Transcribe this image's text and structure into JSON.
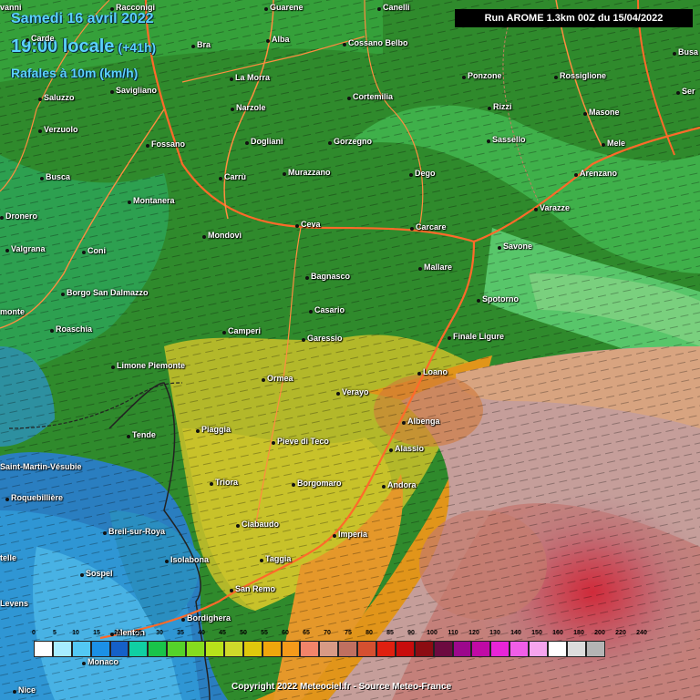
{
  "header": {
    "date_line": "Samedi 16 avril 2022",
    "time_line": "19:00 locale",
    "lead": "(+41h)",
    "param": "Rafales à 10m (km/h)",
    "run": "Run AROME 1.3km 00Z du 15/04/2022"
  },
  "cities": [
    "Racconigi",
    "Guarene",
    "Canelli",
    "Carde",
    "Bra",
    "Alba",
    "Cossano Belbo",
    "Saluzzo",
    "Savigliano",
    "La Morra",
    "Ponzone",
    "Rossiglione",
    "Narzole",
    "Cortemilia",
    "Rizzi",
    "Masone",
    "Verzuolo",
    "Dogliani",
    "Gorzegno",
    "Sassello",
    "Mele",
    "Fossano",
    "Busca",
    "Carrù",
    "Murazzano",
    "Dego",
    "Arenzano",
    "Montanera",
    "Varazze",
    "Dronero",
    "Mondovì",
    "Ceva",
    "Carcare",
    "Savone",
    "Valgrana",
    "Coni",
    "Mallare",
    "Bagnasco",
    "Spotorno",
    "Borgo San Dalmazzo",
    "Casario",
    "Roaschia",
    "Camperi",
    "Garessio",
    "Finale Ligure",
    "Limone Piemonte",
    "Loano",
    "Ormea",
    "Verayo",
    "Tende",
    "Piaggia",
    "Albenga",
    "Pieve di Teco",
    "Alassio",
    "Saint-Martin-Vésubie",
    "Triora",
    "Borgomaro",
    "Andora",
    "Roquebillière",
    "Breil-sur-Roya",
    "Ciabaudo",
    "Imperia",
    "Sospel",
    "Isolabona",
    "Taggia",
    "San Remo",
    "Levens",
    "Bordighera",
    "Menton",
    "Monaco",
    "Nice",
    "Busa",
    "Ser",
    "vanni",
    "monte",
    "telle"
  ],
  "scale": {
    "labels": [
      "0",
      "5",
      "10",
      "15",
      "20",
      "25",
      "30",
      "35",
      "40",
      "45",
      "50",
      "55",
      "60",
      "65",
      "70",
      "75",
      "80",
      "85",
      "90",
      "100",
      "110",
      "120",
      "130",
      "140",
      "150",
      "160",
      "180",
      "200",
      "220",
      "240"
    ],
    "colors": [
      "#ffffff",
      "#a7ecff",
      "#53c8f4",
      "#1b90e6",
      "#1560c8",
      "#10cfa3",
      "#19c44a",
      "#55d22a",
      "#86dc1e",
      "#b8e21a",
      "#cfd92a",
      "#e0c80c",
      "#f0a60c",
      "#f59a1a",
      "#f2846a",
      "#d89a86",
      "#c07060",
      "#d55030",
      "#e02010",
      "#c80c0c",
      "#8c0c12",
      "#6c0a40",
      "#9c088c",
      "#c00aa6",
      "#e824d8",
      "#f05ee8",
      "#f6a4ee",
      "#ffffff",
      "#dcdcdc",
      "#b4b4b4"
    ]
  },
  "copyright": "Copyright 2022 Meteociel.fr - Source Meteo-France"
}
